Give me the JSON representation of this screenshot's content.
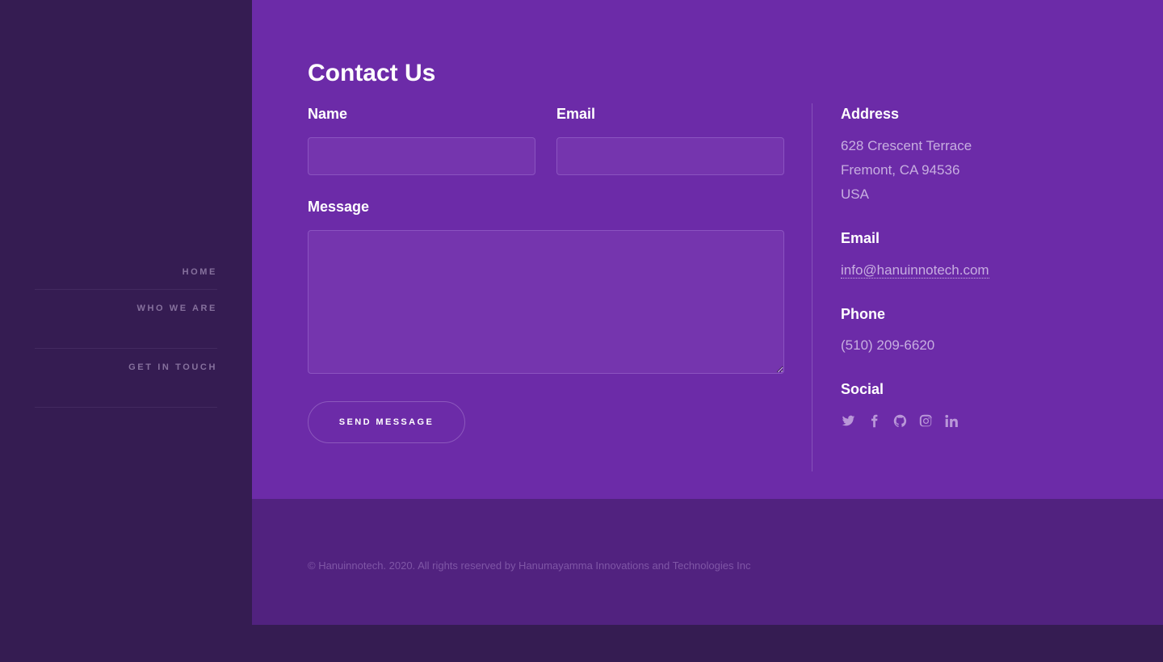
{
  "nav": {
    "items": [
      {
        "label": "HOME"
      },
      {
        "label": "WHO WE ARE"
      },
      {
        "label": "GET IN TOUCH"
      }
    ]
  },
  "contact": {
    "title": "Contact Us",
    "name_label": "Name",
    "email_label": "Email",
    "message_label": "Message",
    "name_value": "",
    "email_value": "",
    "message_value": "",
    "send_label": "SEND MESSAGE"
  },
  "info": {
    "address_heading": "Address",
    "address_lines": [
      "628 Crescent Terrace",
      "Fremont, CA 94536",
      "USA"
    ],
    "email_heading": "Email",
    "email": "info@hanuinnotech.com",
    "phone_heading": "Phone",
    "phone": "(510) 209-6620",
    "social_heading": "Social",
    "social_icons": [
      "twitter-icon",
      "facebook-icon",
      "github-icon",
      "instagram-icon",
      "linkedin-icon"
    ]
  },
  "footer": {
    "text": "© Hanuinnotech. 2020. All rights reserved by Hanumayamma Innovations and Technologies Inc"
  },
  "colors": {
    "sidebar_bg": "#351c52",
    "main_bg": "#6c2ba8",
    "footer_bg": "#51227f",
    "field_bg": "#7535ae",
    "muted_text": "#c7aee0"
  }
}
